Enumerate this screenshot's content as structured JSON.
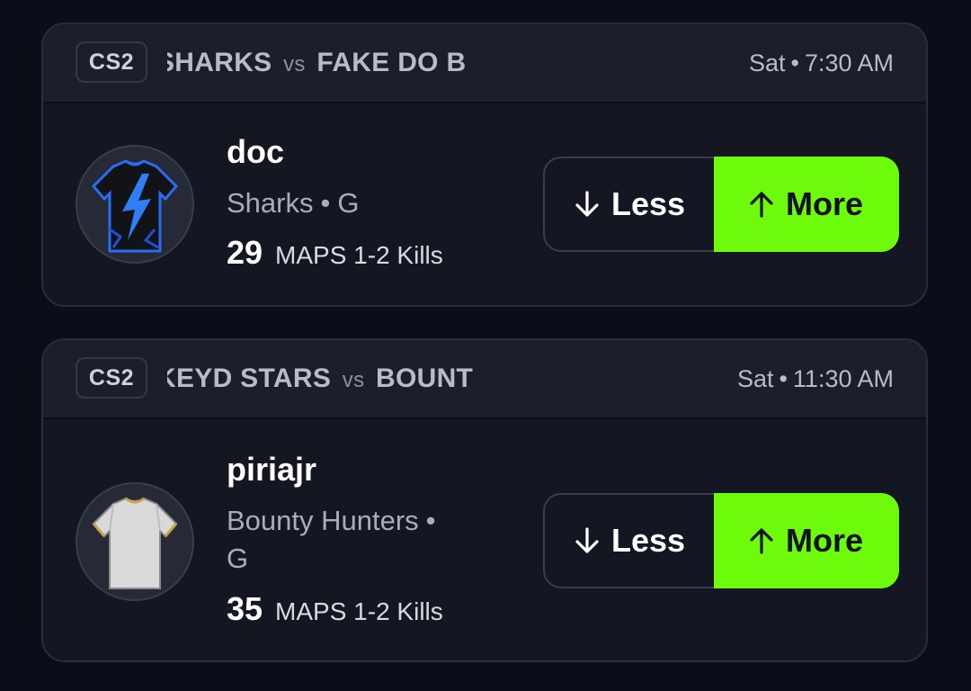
{
  "cards": [
    {
      "game": "CS2",
      "team_a": "SHARKS",
      "vs": "vs",
      "team_b": "FAKE DO B",
      "day": "Sat",
      "time": "7:30 AM",
      "player": "doc",
      "team": "Sharks",
      "position": "G",
      "stat_value": "29",
      "stat_label": "MAPS 1-2 Kills",
      "less_label": "Less",
      "more_label": "More",
      "avatar_icon": "blue-jersey-icon"
    },
    {
      "game": "CS2",
      "team_a": "KEYD STARS",
      "vs": "vs",
      "team_b": "BOUNT",
      "day": "Sat",
      "time": "11:30 AM",
      "player": "piriajr",
      "team": "Bounty Hunters",
      "position": "G",
      "stat_value": "35",
      "stat_label": "MAPS 1-2 Kills",
      "less_label": "Less",
      "more_label": "More",
      "avatar_icon": "white-jersey-icon"
    }
  ],
  "colors": {
    "background": "#0b0e19",
    "card": "#141722",
    "header": "#1c1f2b",
    "accent_more": "#6dfa0b"
  }
}
